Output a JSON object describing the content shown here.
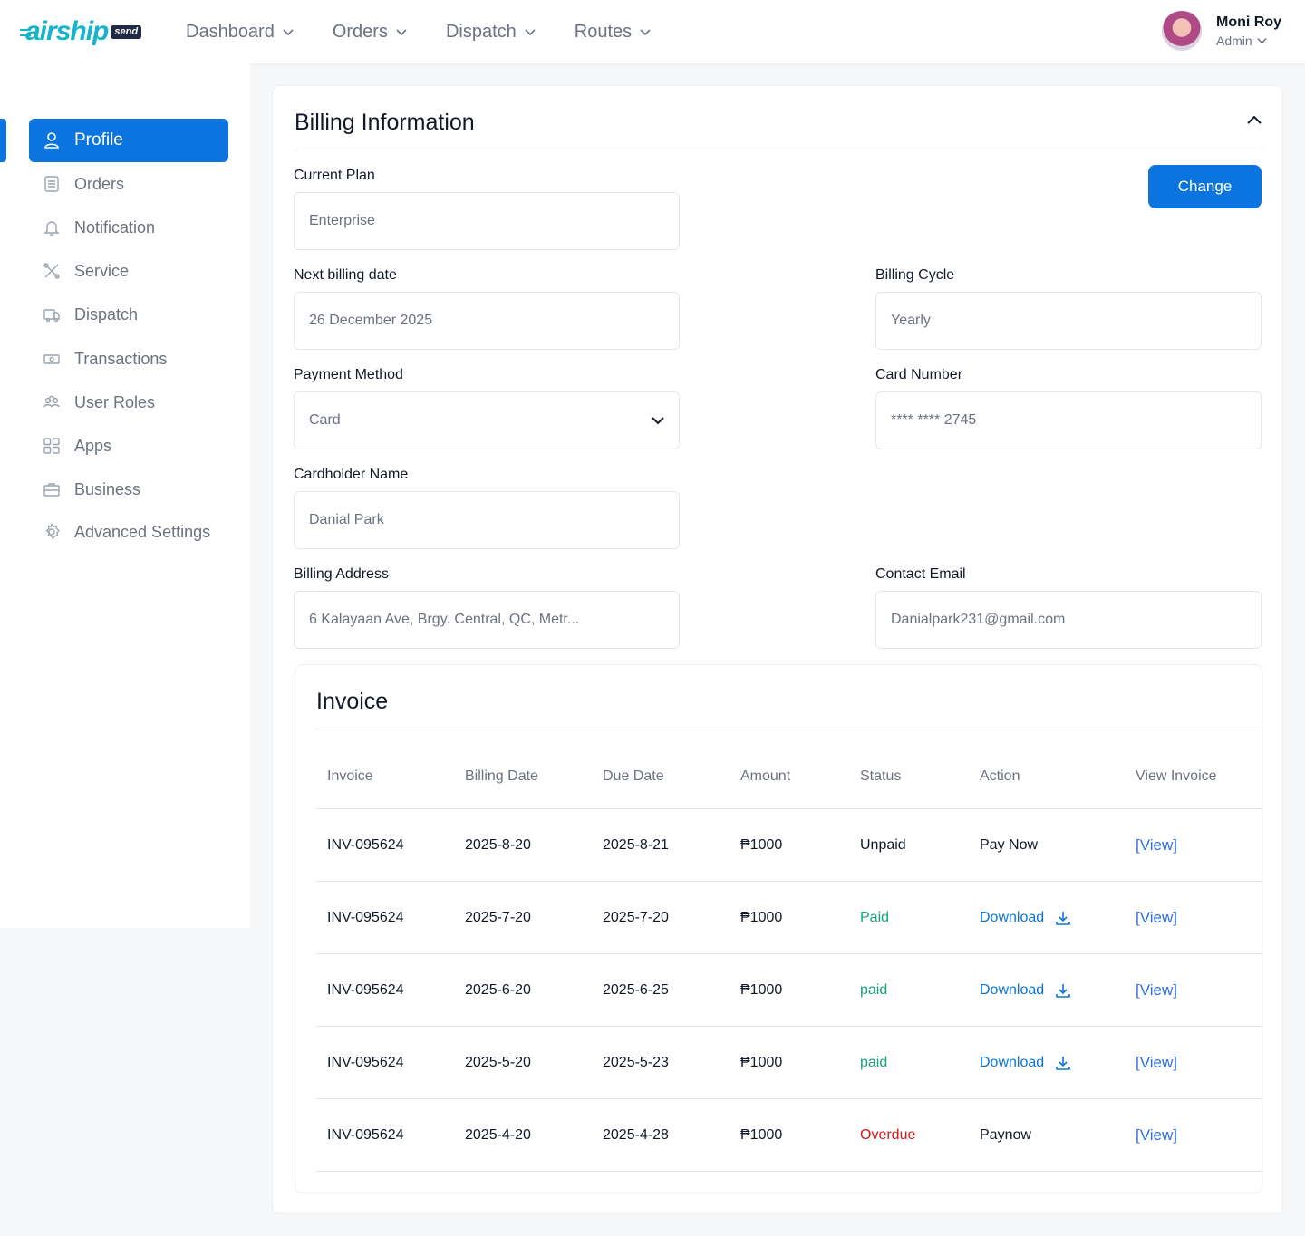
{
  "brand": {
    "name": "airship",
    "badge": "send",
    "color": "#15b3cc"
  },
  "nav": [
    {
      "label": "Dashboard"
    },
    {
      "label": "Orders"
    },
    {
      "label": "Dispatch"
    },
    {
      "label": "Routes"
    }
  ],
  "user": {
    "name": "Moni Roy",
    "role": "Admin"
  },
  "sidebar": {
    "items": [
      {
        "label": "Profile",
        "icon": "user-icon",
        "active": true
      },
      {
        "label": "Orders",
        "icon": "list-icon"
      },
      {
        "label": "Notification",
        "icon": "bell-icon"
      },
      {
        "label": "Service",
        "icon": "tools-icon"
      },
      {
        "label": "Dispatch",
        "icon": "truck-icon"
      },
      {
        "label": "Transactions",
        "icon": "cash-icon"
      },
      {
        "label": "User Roles",
        "icon": "users-icon"
      },
      {
        "label": "Apps",
        "icon": "grid-icon"
      },
      {
        "label": "Business",
        "icon": "briefcase-icon"
      },
      {
        "label": "Advanced Settings",
        "icon": "gear-icon"
      }
    ]
  },
  "billing": {
    "title": "Billing Information",
    "change_label": "Change",
    "current_plan": {
      "label": "Current Plan",
      "value": "Enterprise"
    },
    "next_billing_date": {
      "label": "Next billing date",
      "value": "26 December 2025"
    },
    "billing_cycle": {
      "label": "Billing Cycle",
      "value": "Yearly"
    },
    "payment_method": {
      "label": "Payment Method",
      "value": "Card"
    },
    "card_number": {
      "label": "Card Number",
      "value": "**** **** 2745"
    },
    "cardholder_name": {
      "label": "Cardholder Name",
      "value": "Danial Park"
    },
    "billing_address": {
      "label": "Billing Address",
      "value": "6 Kalayaan Ave, Brgy. Central, QC, Metr..."
    },
    "contact_email": {
      "label": "Contact Email",
      "value": "Danialpark231@gmail.com"
    }
  },
  "invoice": {
    "title": "Invoice",
    "columns": [
      "Invoice",
      "Billing Date",
      "Due Date",
      "Amount",
      "Status",
      "Action",
      "View Invoice"
    ],
    "rows": [
      {
        "invoice": "INV-095624",
        "billing_date": "2025-8-20",
        "due_date": "2025-8-21",
        "amount": "₱1000",
        "status": "Unpaid",
        "action": "Pay Now",
        "view": "[View]"
      },
      {
        "invoice": "INV-095624",
        "billing_date": "2025-7-20",
        "due_date": "2025-7-20",
        "amount": "₱1000",
        "status": "Paid",
        "action": "Download",
        "view": "[View]"
      },
      {
        "invoice": "INV-095624",
        "billing_date": "2025-6-20",
        "due_date": "2025-6-25",
        "amount": "₱1000",
        "status": "paid",
        "action": "Download",
        "view": "[View]"
      },
      {
        "invoice": "INV-095624",
        "billing_date": "2025-5-20",
        "due_date": "2025-5-23",
        "amount": "₱1000",
        "status": "paid",
        "action": "Download",
        "view": "[View]"
      },
      {
        "invoice": "INV-095624",
        "billing_date": "2025-4-20",
        "due_date": "2025-4-28",
        "amount": "₱1000",
        "status": "Overdue",
        "action": "Paynow",
        "view": "[View]"
      }
    ]
  },
  "colors": {
    "primary": "#0b74de",
    "paid": "#16a37f",
    "overdue": "#d1181b"
  }
}
